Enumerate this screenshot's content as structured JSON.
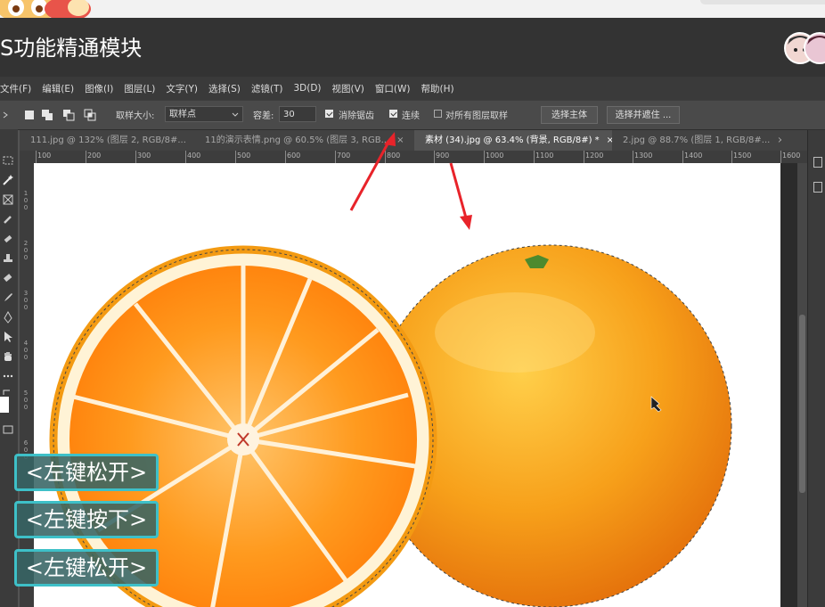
{
  "app": {
    "title": "S功能精通模块"
  },
  "menu": [
    "文件(F)",
    "编辑(E)",
    "图像(I)",
    "图层(L)",
    "文字(Y)",
    "选择(S)",
    "滤镜(T)",
    "3D(D)",
    "视图(V)",
    "窗口(W)",
    "帮助(H)"
  ],
  "options": {
    "sample_size_label": "取样大小:",
    "sample_size_value": "取样点",
    "tolerance_label": "容差:",
    "tolerance_value": "30",
    "antialias_label": "消除锯齿",
    "antialias_checked": true,
    "contiguous_label": "连续",
    "contiguous_checked": true,
    "all_layers_label": "对所有图层取样",
    "all_layers_checked": false,
    "select_subject_label": "选择主体",
    "select_and_mask_label": "选择并遮住 ..."
  },
  "tabs": [
    {
      "label": "111.jpg @ 132% (图层 2, RGB/8#...",
      "close": "×",
      "active": false
    },
    {
      "label": "11的演示表情.png @ 60.5% (图层 3, RGB...",
      "close": "×",
      "active": false
    },
    {
      "label": "素材 (34).jpg @ 63.4% (背景, RGB/8#) *",
      "close": "×",
      "active": true
    },
    {
      "label": "2.jpg @ 88.7% (图层 1, RGB/8#...",
      "close": "×",
      "active": false
    }
  ],
  "ruler": {
    "h_labels": [
      "100",
      "200",
      "300",
      "400",
      "500",
      "600",
      "700",
      "800",
      "900",
      "1000",
      "1100",
      "1200",
      "1300",
      "1400",
      "1500",
      "1600"
    ],
    "v_labels": [
      "1",
      "0",
      "0",
      "2",
      "0",
      "0",
      "3",
      "0",
      "0",
      "4",
      "0",
      "0",
      "5",
      "0",
      "0",
      "6",
      "0",
      "0"
    ]
  },
  "overlay": {
    "key_hints": [
      "<左键松开>",
      "<左键按下>",
      "<左键松开>"
    ]
  },
  "colors": {
    "annotation_arrow": "#e8232a",
    "key_hint_border": "#3ec0c8",
    "orange_peel": "#f39a12",
    "orange_flesh": "#ff8f0f"
  },
  "icons": {
    "tools": [
      "marquee-icon",
      "magic-wand-icon",
      "crop-icon",
      "eyedropper-icon",
      "healing-icon",
      "stamp-icon",
      "eraser-icon",
      "brush-icon",
      "pen-icon",
      "select-arrow-icon",
      "hand-icon",
      "more-icon",
      "swap-icon",
      "color-swatch-icon",
      "screen-mode-icon"
    ]
  }
}
